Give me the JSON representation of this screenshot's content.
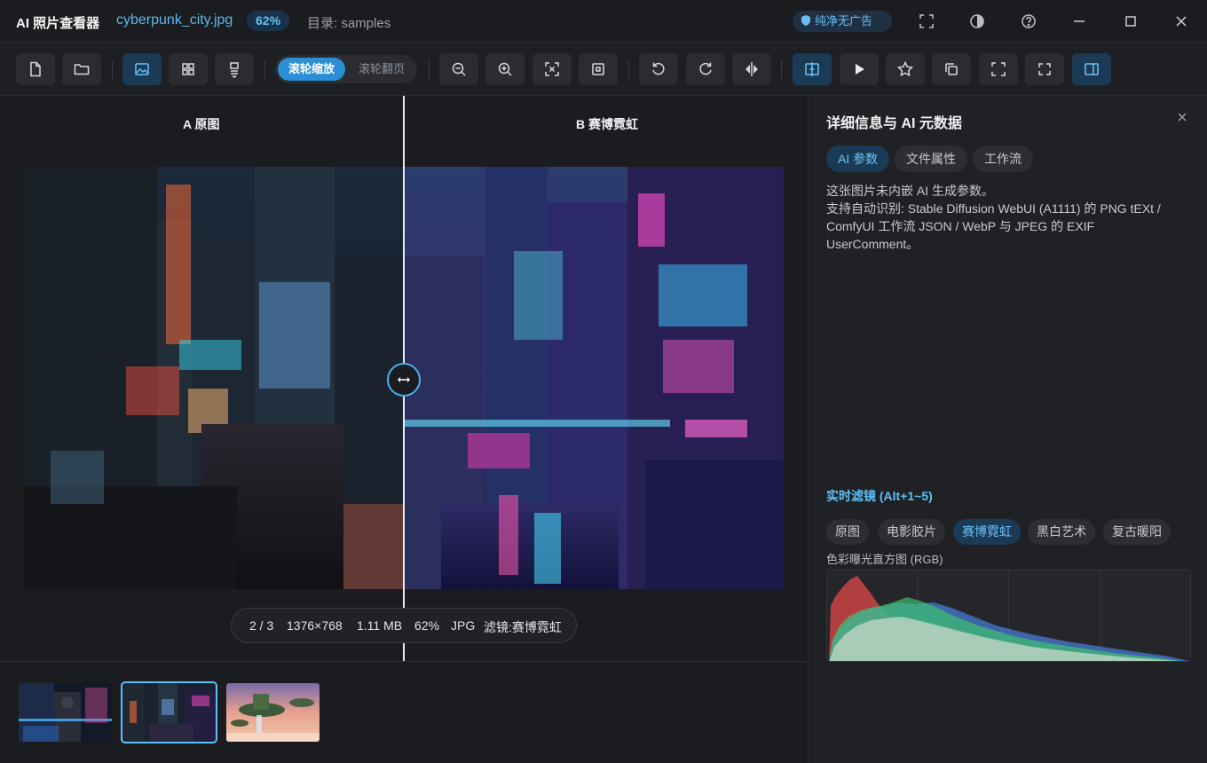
{
  "titlebar": {
    "app_title": "AI 照片查看器",
    "file_name": "cyberpunk_city.jpg",
    "zoom": "62%",
    "directory": "目录: samples",
    "adfree_badge": "纯净无广告"
  },
  "toolbar": {
    "wheel_zoom": "滚轮缩放",
    "wheel_page": "滚轮翻页"
  },
  "viewer": {
    "label_a": "A 原图",
    "label_b": "B 赛博霓虹",
    "info": {
      "index": "2 / 3",
      "dimensions": "1376×768",
      "size": "1.11 MB",
      "zoom": "62%",
      "format": "JPG",
      "filter": "滤镜:赛博霓虹"
    }
  },
  "panel": {
    "title": "详细信息与 AI 元数据",
    "tabs": [
      "AI 参数",
      "文件属性",
      "工作流"
    ],
    "active_tab": "AI 参数",
    "note_line1": "这张图片未内嵌 AI 生成参数。",
    "note_line2": "支持自动识别: Stable Diffusion WebUI (A1111) 的 PNG tEXt / ComfyUI 工作流 JSON / WebP 与 JPEG 的 EXIF UserComment。",
    "filters_heading": "实时滤镜 (Alt+1~5)",
    "filters": [
      "原图",
      "电影胶片",
      "赛博霓虹",
      "黑白艺术",
      "复古暖阳"
    ],
    "active_filter": "赛博霓虹",
    "histogram_label": "色彩曝光直方图 (RGB)"
  },
  "colors": {
    "accent": "#5cc0f8",
    "accent_bg": "#1b3a56",
    "hist_red": "#e04848",
    "hist_green": "#3ec86a",
    "hist_blue": "#4a7fe0"
  }
}
